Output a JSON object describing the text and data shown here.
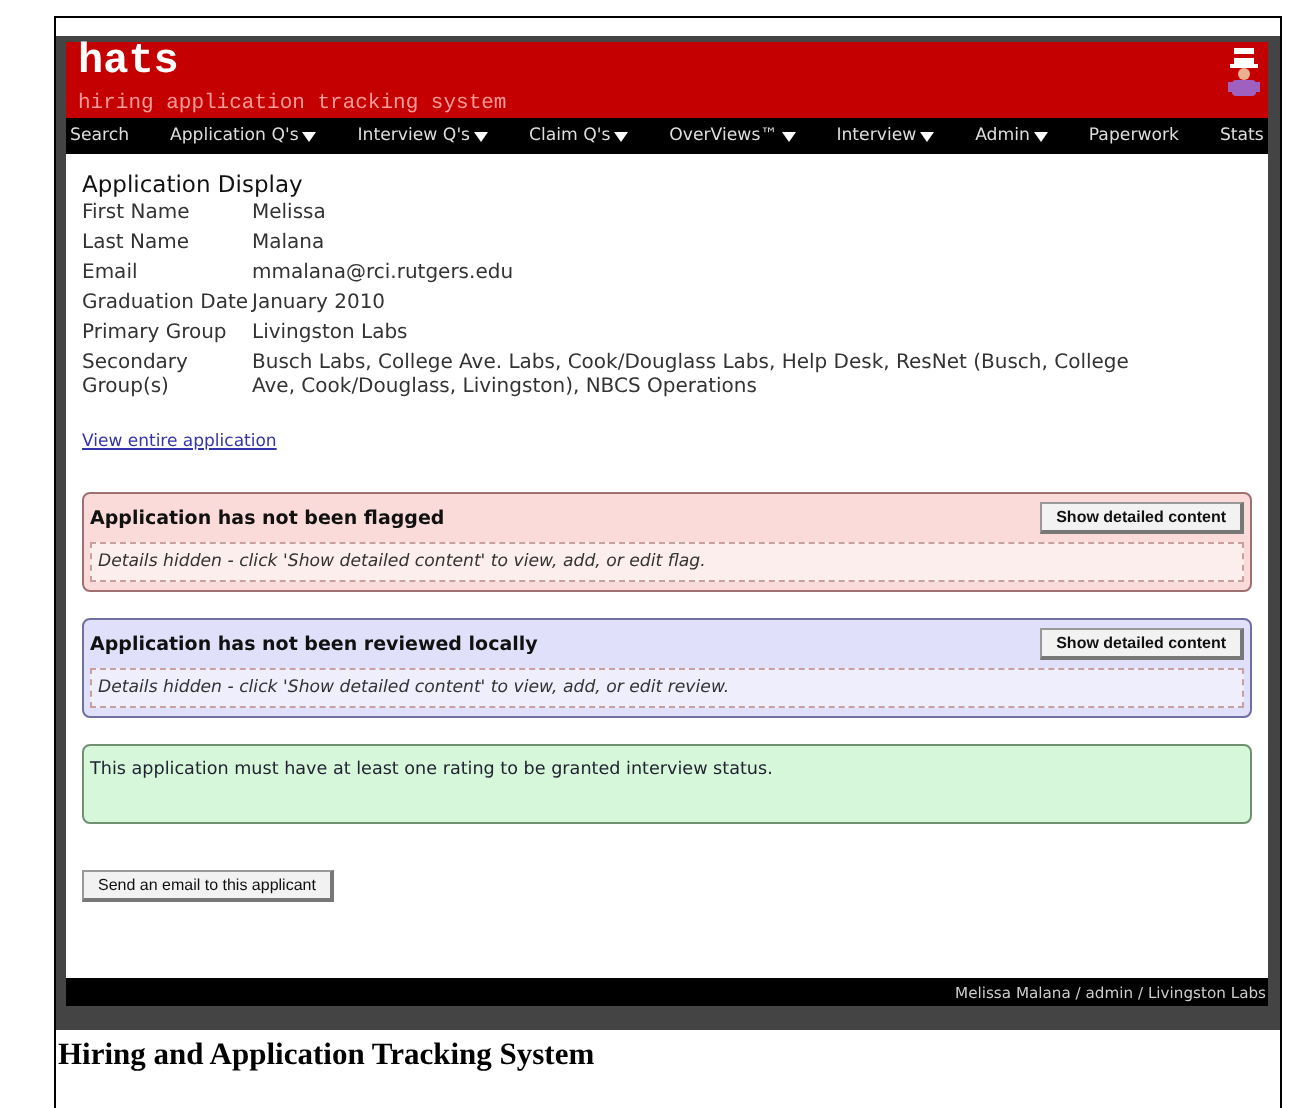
{
  "header": {
    "logo": "hats",
    "subtitle": "hiring application tracking system"
  },
  "nav": [
    {
      "label": "Search",
      "dropdown": false
    },
    {
      "label": "Application Q's",
      "dropdown": true
    },
    {
      "label": "Interview Q's",
      "dropdown": true
    },
    {
      "label": "Claim Q's",
      "dropdown": true
    },
    {
      "label": "OverViews™",
      "dropdown": true
    },
    {
      "label": "Interview",
      "dropdown": true
    },
    {
      "label": "Admin",
      "dropdown": true
    },
    {
      "label": "Paperwork",
      "dropdown": false
    },
    {
      "label": "Stats",
      "dropdown": false
    }
  ],
  "page_title": "Application Display",
  "fields": [
    {
      "label": "First Name",
      "value": "Melissa"
    },
    {
      "label": "Last Name",
      "value": "Malana"
    },
    {
      "label": "Email",
      "value": "mmalana@rci.rutgers.edu"
    },
    {
      "label": "Graduation Date",
      "value": "January 2010"
    },
    {
      "label": "Primary Group",
      "value": "Livingston Labs"
    },
    {
      "label": "Secondary Group(s)",
      "value": "Busch Labs, College Ave. Labs, Cook/Douglass Labs, Help Desk, ResNet (Busch, College Ave, Cook/Douglass, Livingston), NBCS Operations"
    }
  ],
  "link": "View entire application",
  "panels": [
    {
      "kind": "flag",
      "title": "Application has not been flagged",
      "button": "Show detailed content",
      "details": "Details hidden - click 'Show detailed content' to view, add, or edit flag."
    },
    {
      "kind": "review",
      "title": "Application has not been reviewed locally",
      "button": "Show detailed content",
      "details": "Details hidden - click 'Show detailed content' to view, add, or edit review."
    },
    {
      "kind": "notice",
      "text": "This application must have at least one rating to be granted interview status."
    }
  ],
  "email_button": "Send an email to this applicant",
  "footer": "Melissa Malana / admin / Livingston Labs",
  "caption": "Hiring and Application Tracking System"
}
